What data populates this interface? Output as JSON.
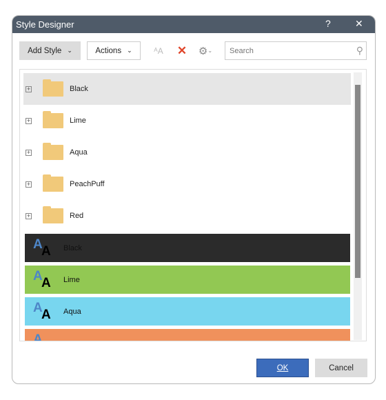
{
  "window": {
    "title": "Style Designer",
    "help": "?",
    "close": "✕"
  },
  "toolbar": {
    "add_style": "Add Style",
    "actions": "Actions",
    "search_placeholder": "Search"
  },
  "folders": [
    {
      "label": "Black"
    },
    {
      "label": "Lime"
    },
    {
      "label": "Aqua"
    },
    {
      "label": "PeachPuff"
    },
    {
      "label": "Red"
    }
  ],
  "styles": [
    {
      "label": "Black",
      "color": "#2b2b2b"
    },
    {
      "label": "Lime",
      "color": "#92c853"
    },
    {
      "label": "Aqua",
      "color": "#78d6ef"
    },
    {
      "label": "",
      "color": "#f0915c"
    }
  ],
  "footer": {
    "ok": "OK",
    "cancel": "Cancel"
  }
}
